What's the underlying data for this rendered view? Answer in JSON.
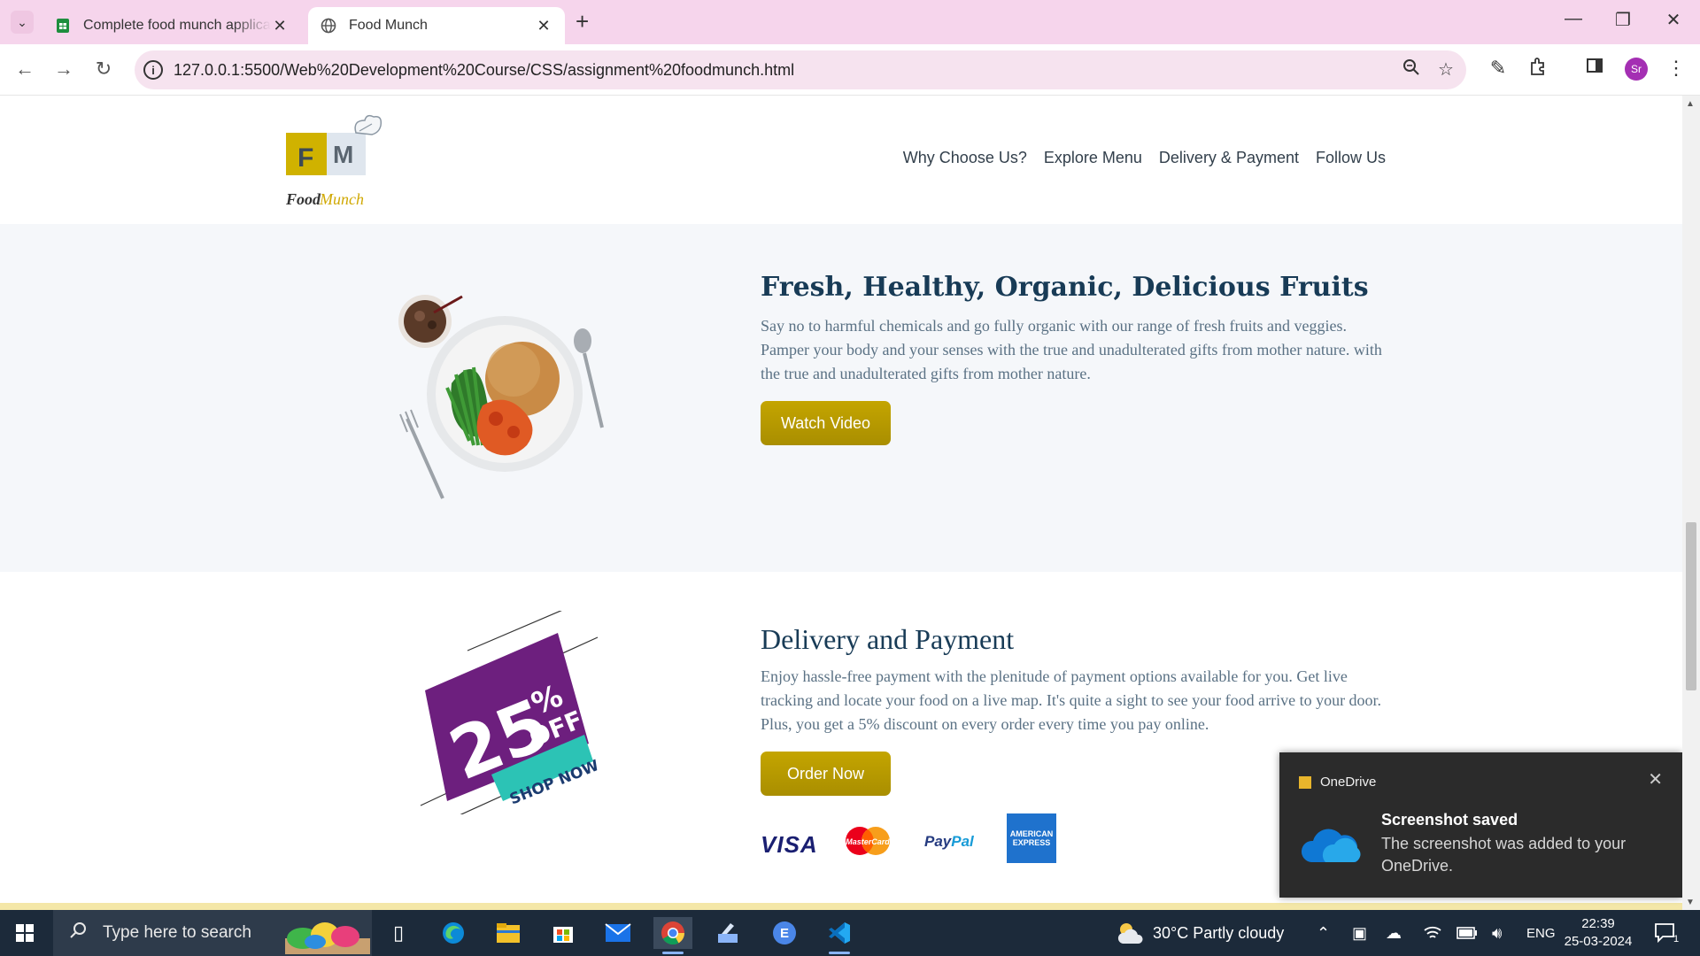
{
  "browser": {
    "tabs": [
      {
        "title": "Complete food munch applicat",
        "icon": "sheets-icon",
        "active": false
      },
      {
        "title": "Food Munch",
        "icon": "globe-icon",
        "active": true
      }
    ],
    "url": "127.0.0.1:5500/Web%20Development%20Course/CSS/assignment%20foodmunch.html",
    "profile_initials": "Sr"
  },
  "page": {
    "logo_text_food": "Food",
    "logo_text_munch": "Munch",
    "logo_letter_f": "F",
    "logo_letter_m": "M",
    "nav": [
      "Why Choose Us?",
      "Explore Menu",
      "Delivery & Payment",
      "Follow Us"
    ],
    "fruits": {
      "heading": "Fresh, Healthy, Organic, Delicious Fruits",
      "text": "Say no to harmful chemicals and go fully organic with our range of fresh fruits and veggies. Pamper your body and your senses with the true and unadulterated gifts from mother nature. with the true and unadulterated gifts from mother nature.",
      "button": "Watch Video"
    },
    "delivery": {
      "heading": "Delivery and Payment",
      "text": "Enjoy hassle-free payment with the plenitude of payment options available for you. Get live tracking and locate your food on a live map. It's quite a sight to see your food arrive to your door. Plus, you get a 5% discount on every order every time you pay online.",
      "button": "Order Now",
      "promo_number": "25",
      "promo_percent": "%",
      "promo_off": "OFF",
      "promo_shop": "SHOP NOW",
      "cards": {
        "visa": "VISA",
        "mastercard": "MasterCard",
        "paypal_a": "Pay",
        "paypal_b": "Pal",
        "amex": "AMERICAN EXPRESS"
      }
    }
  },
  "toast": {
    "app": "OneDrive",
    "title": "Screenshot saved",
    "body": "The screenshot was added to your OneDrive."
  },
  "taskbar": {
    "search_placeholder": "Type here to search",
    "weather": "30°C  Partly cloudy",
    "lang": "ENG",
    "time": "22:39",
    "date": "25-03-2024",
    "notification_count": "1"
  }
}
